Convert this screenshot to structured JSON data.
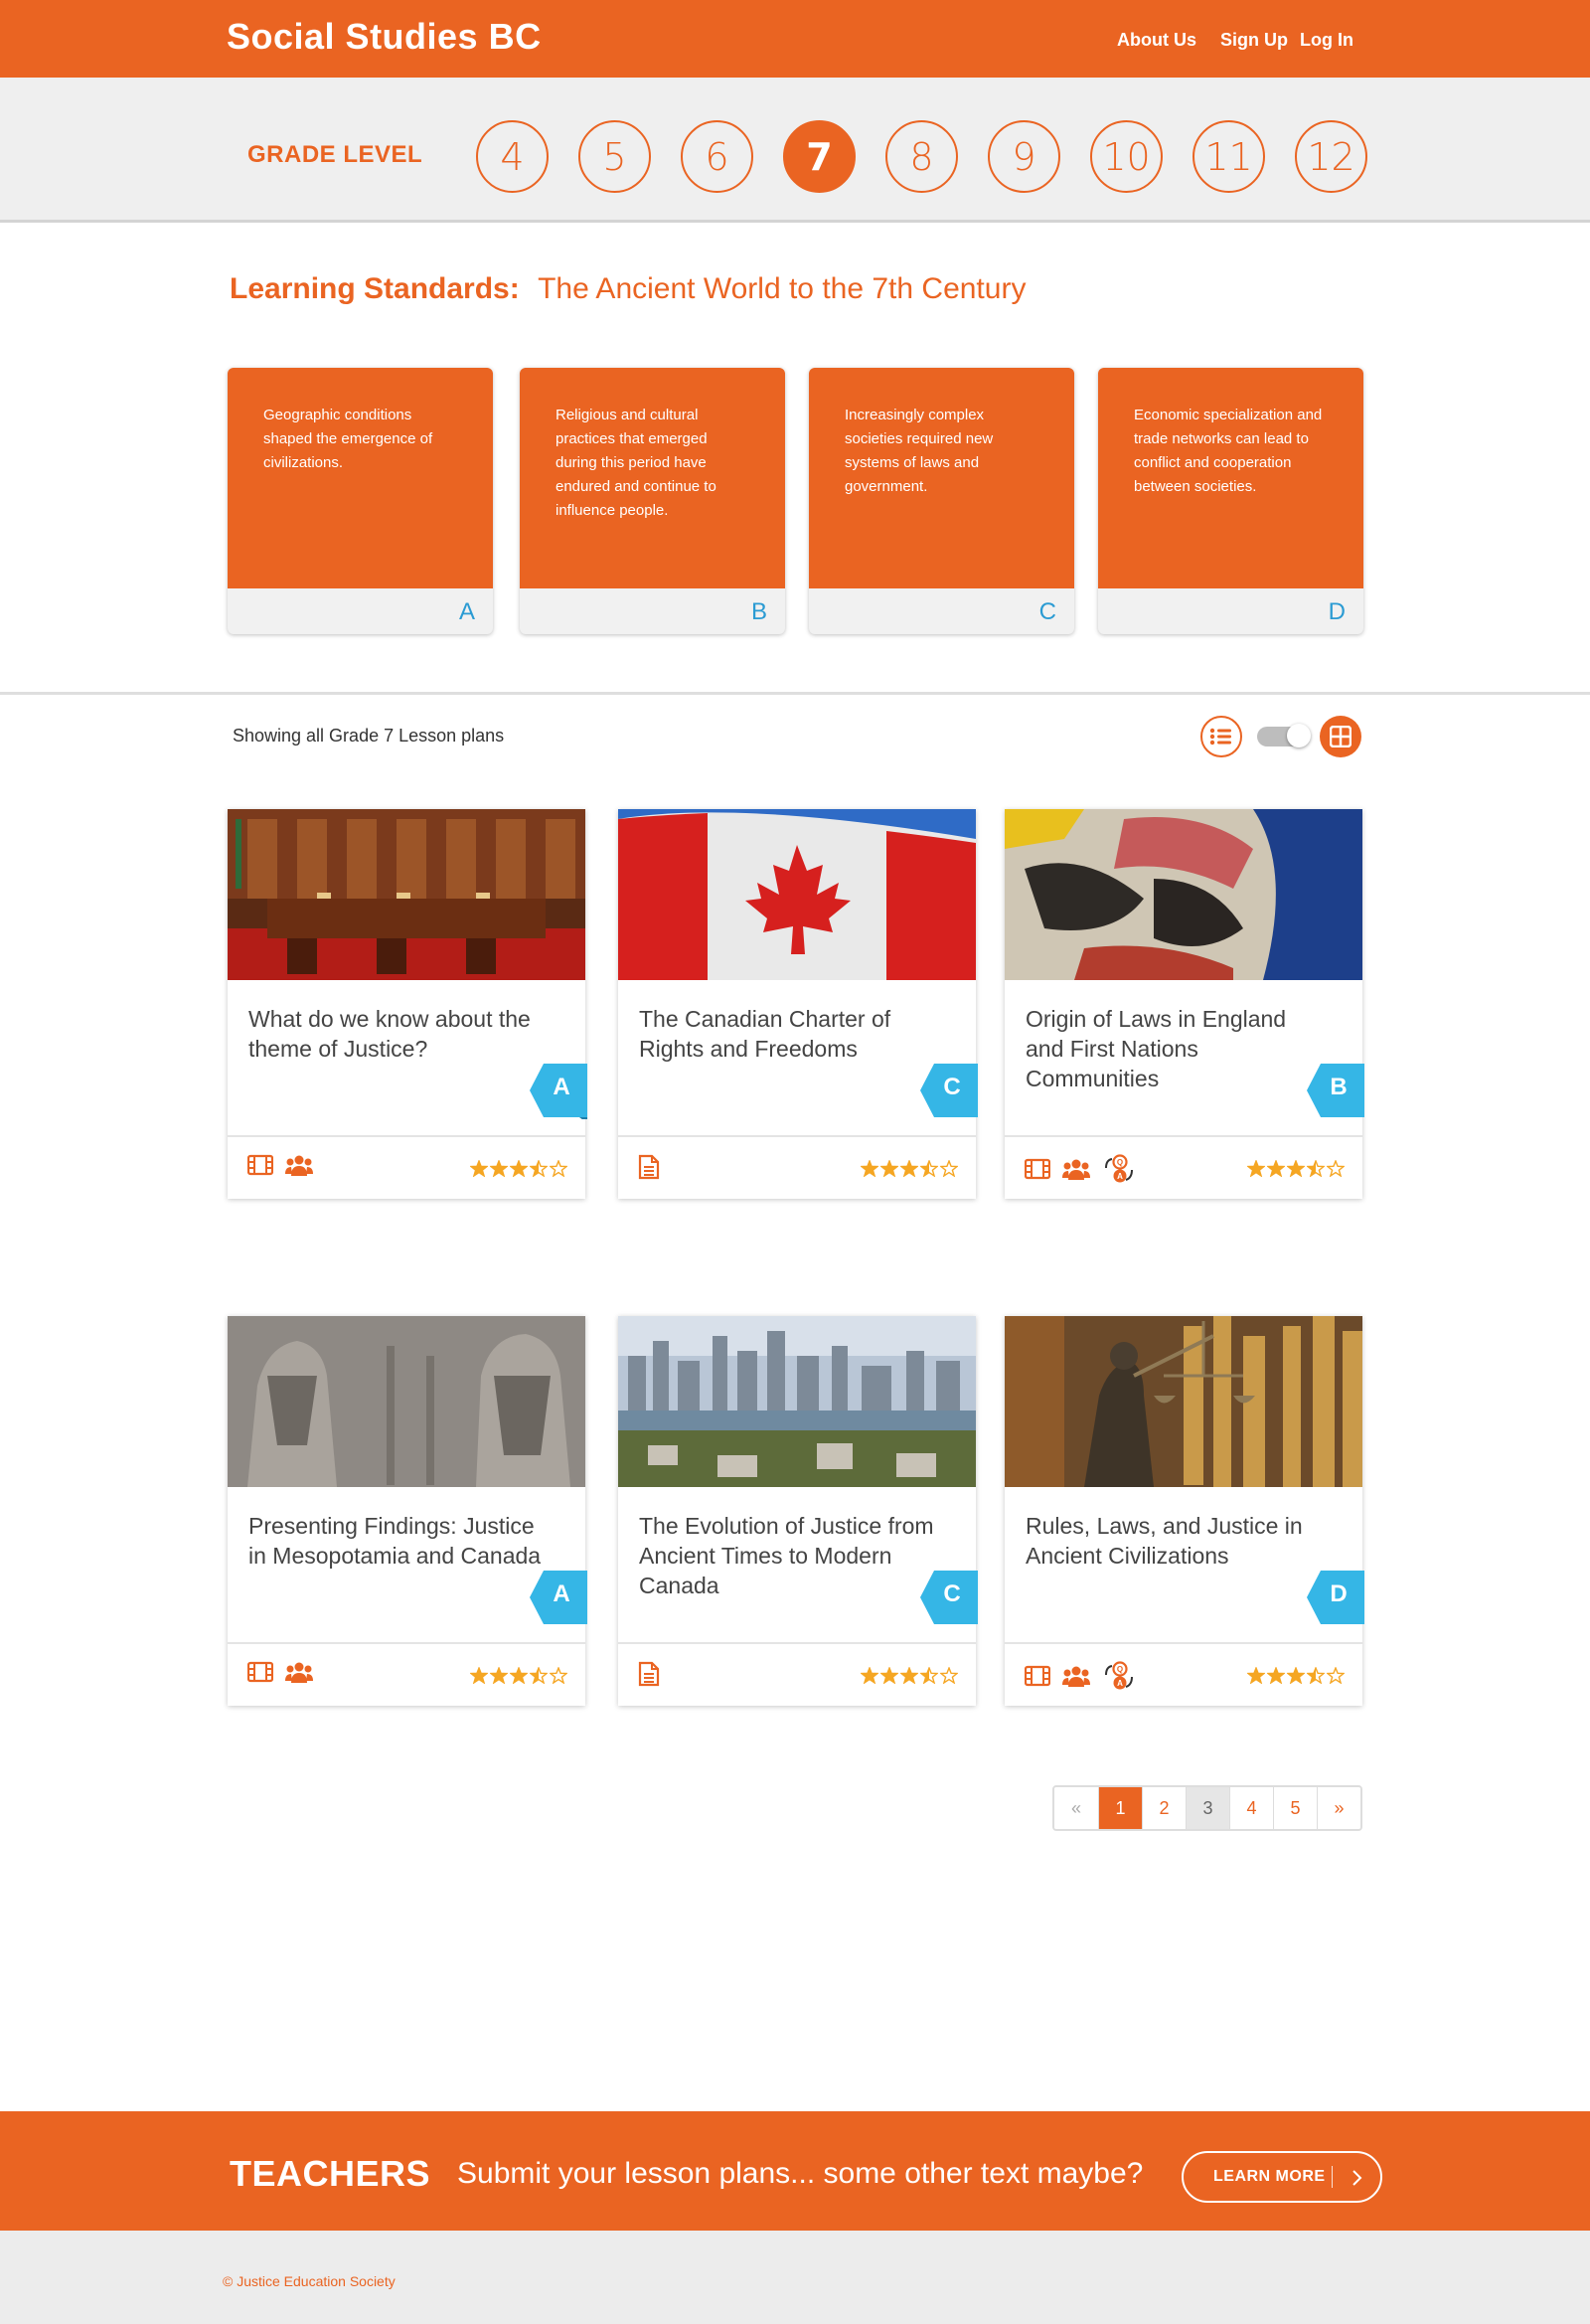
{
  "header": {
    "brand": "Social Studies BC",
    "nav": [
      "About Us",
      "Sign Up",
      "Log In"
    ]
  },
  "grade_bar": {
    "label": "GRADE LEVEL",
    "grades": [
      "4",
      "5",
      "6",
      "7",
      "8",
      "9",
      "10",
      "11",
      "12"
    ],
    "selected": "7"
  },
  "learning_standards": {
    "heading": "Learning Standards:",
    "subtitle": "The Ancient World to the 7th Century",
    "cards": [
      {
        "text": "Geographic conditions shaped the emergence of civilizations.",
        "letter": "A"
      },
      {
        "text": "Religious and cultural practices that emerged during this period have endured and continue to influence people.",
        "letter": "B"
      },
      {
        "text": "Increasingly complex societies required new systems of laws and government.",
        "letter": "C"
      },
      {
        "text": "Economic specialization and trade networks can lead to conflict and cooperation between societies.",
        "letter": "D"
      }
    ]
  },
  "lessons_header": {
    "showing": "Showing all Grade 7 Lesson plans",
    "view_mode": "grid"
  },
  "lessons": [
    {
      "title": "What do we know about the theme of Justice?",
      "tag": "A",
      "image": "courtroom",
      "icons": [
        "film-icon",
        "group-icon"
      ],
      "rating": 3.5
    },
    {
      "title": "The Canadian Charter of Rights and Freedoms",
      "tag": "C",
      "image": "canadian-flag",
      "icons": [
        "document-icon"
      ],
      "rating": 3.5
    },
    {
      "title": "Origin of Laws in England and First Nations Communities",
      "tag": "B",
      "image": "totem-pole",
      "icons": [
        "film-icon",
        "group-icon",
        "qa-icon"
      ],
      "rating": 3.5
    },
    {
      "title": "Presenting Findings: Justice in Mesopotamia and Canada",
      "tag": "A",
      "image": "assyrian-relief",
      "icons": [
        "film-icon",
        "group-icon"
      ],
      "rating": 3.5
    },
    {
      "title": " The Evolution of Justice from Ancient Times to Modern Canada",
      "tag": "C",
      "image": "vancouver-skyline",
      "icons": [
        "document-icon"
      ],
      "rating": 3.5
    },
    {
      "title": "Rules, Laws, and Justice in Ancient Civilizations",
      "tag": "D",
      "image": "lady-justice",
      "icons": [
        "film-icon",
        "group-icon",
        "qa-icon"
      ],
      "rating": 3.5
    }
  ],
  "pagination": {
    "prev": "«",
    "pages": [
      "1",
      "2",
      "3",
      "4",
      "5"
    ],
    "current": "1",
    "next": "»"
  },
  "banner": {
    "title": "TEACHERS",
    "text": "Submit your lesson plans... some other text maybe?",
    "button": "LEARN MORE"
  },
  "footer": {
    "copyright": "© Justice Education Society"
  },
  "colors": {
    "accent": "#ea6422",
    "tag_blue": "#35b6e6",
    "star": "#f5a623"
  }
}
